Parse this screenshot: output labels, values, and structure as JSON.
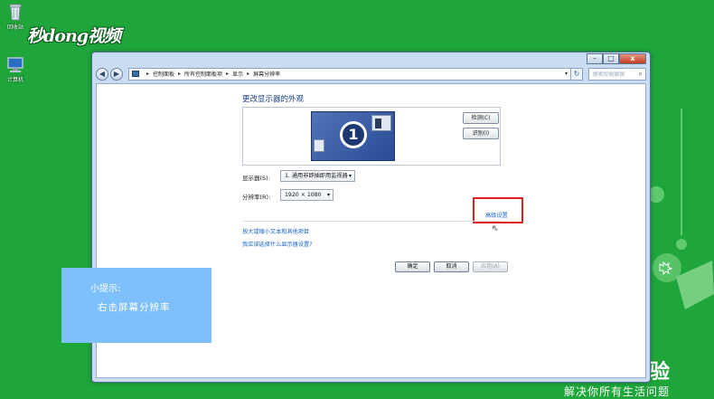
{
  "desktop": {
    "icons": [
      {
        "label": "回收站",
        "icon": "recycle-bin-icon"
      },
      {
        "label": "计算机",
        "icon": "computer-icon"
      }
    ],
    "logo": "秒dong视频",
    "brand_tail": "验",
    "slogan": "解决你所有生活问题"
  },
  "window": {
    "caption": {
      "minimize": "–",
      "maximize": "□",
      "close": "x"
    },
    "nav": {
      "back": "◀",
      "forward": "▶"
    },
    "breadcrumb": [
      "控制面板",
      "所有控制面板项",
      "显示",
      "屏幕分辨率"
    ],
    "search_placeholder": "搜索控制面板",
    "page_title": "更改显示器的外观",
    "monitor_number": "1",
    "detect_button": "检测(C)",
    "identify_button": "识别(I)",
    "display_label": "显示器(S):",
    "display_value": "1. 通用非即插即用监视器",
    "resolution_label": "分辨率(R):",
    "resolution_value": "1920 × 1080",
    "advanced_link": "高级设置",
    "links": [
      "放大或缩小文本和其他项目",
      "我应该选择什么显示器设置?"
    ],
    "buttons": {
      "ok": "确定",
      "cancel": "取消",
      "apply": "应用(A)"
    }
  },
  "tip": {
    "heading": "小提示:",
    "body": "右击屏幕分辨率"
  },
  "colors": {
    "desktop_bg": "#1ea63a",
    "tip_bg": "#7ec0fb",
    "highlight": "#e02020",
    "link": "#1763c9"
  }
}
